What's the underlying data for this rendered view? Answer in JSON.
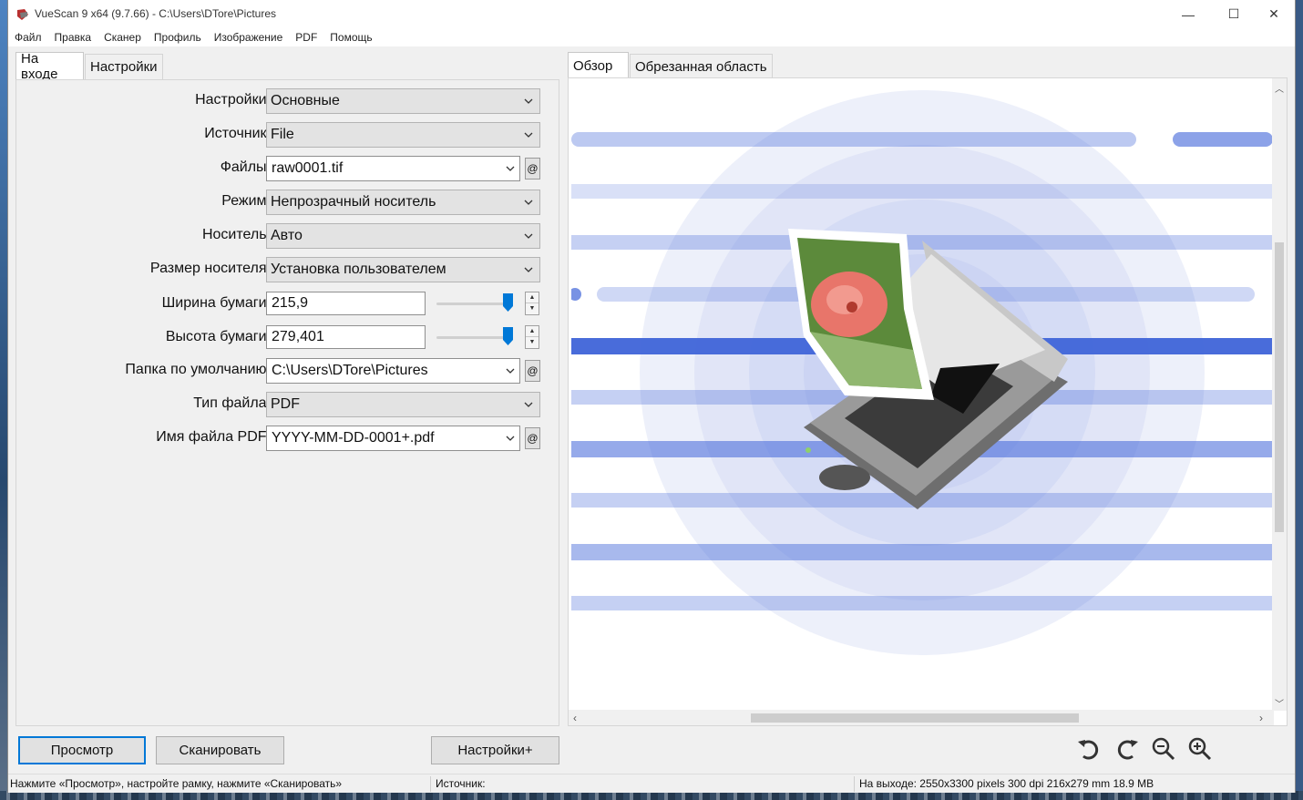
{
  "window": {
    "title": "VueScan 9 x64 (9.7.66) - C:\\Users\\DTore\\Pictures",
    "minimize": "—",
    "maximize": "☐",
    "close": "✕"
  },
  "menu": [
    "Файл",
    "Правка",
    "Сканер",
    "Профиль",
    "Изображение",
    "PDF",
    "Помощь"
  ],
  "left_tabs": [
    "На входе",
    "Настройки"
  ],
  "right_tabs": [
    "Обзор",
    "Обрезанная область"
  ],
  "form": {
    "settings": {
      "label": "Настройки:",
      "value": "Основные"
    },
    "source": {
      "label": "Источник:",
      "value": "File"
    },
    "files": {
      "label": "Файлы:",
      "value": "raw0001.tif",
      "at": "@"
    },
    "mode": {
      "label": "Режим:",
      "value": "Непрозрачный носитель"
    },
    "media": {
      "label": "Носитель:",
      "value": "Авто"
    },
    "media_size": {
      "label": "Размер носителя:",
      "value": "Установка пользователем"
    },
    "paper_width": {
      "label": "Ширина бумаги:",
      "value": "215,9",
      "level": 1.0
    },
    "paper_height": {
      "label": "Высота бумаги:",
      "value": "279,401",
      "level": 1.0
    },
    "default_folder": {
      "label": "Папка по умолчанию:",
      "value": "C:\\Users\\DTore\\Pictures",
      "at": "@"
    },
    "file_type": {
      "label": "Тип файла:",
      "value": "PDF"
    },
    "pdf_filename": {
      "label": "Имя файла PDF:",
      "value": "YYYY-MM-DD-0001+.pdf",
      "at": "@"
    }
  },
  "buttons": {
    "preview": "Просмотр",
    "scan": "Сканировать",
    "more_settings": "Настройки+"
  },
  "toolbar_icons": [
    "rotate-left-icon",
    "rotate-right-icon",
    "zoom-out-icon",
    "zoom-in-icon"
  ],
  "status": {
    "hint": "Нажмите «Просмотр», настройте рамку, нажмите «Сканировать»",
    "source": "Источник:",
    "output": "На выходе: 2550x3300 pixels 300 dpi 216x279 mm 18.9 MB"
  },
  "colors": {
    "accent": "#0078d7",
    "preview_blue": "#3f64d8"
  }
}
